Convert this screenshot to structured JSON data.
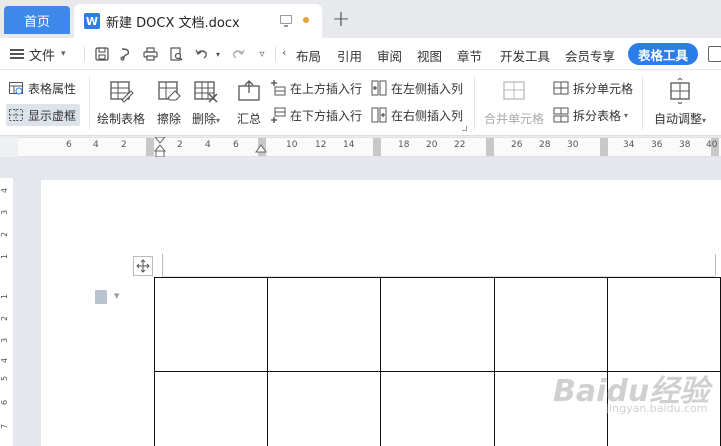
{
  "tabs": {
    "home": "首页",
    "document": "新建 DOCX 文档.docx",
    "doc_logo": "W"
  },
  "menu": {
    "file": "文件"
  },
  "ribbon_tabs": [
    "布局",
    "引用",
    "审阅",
    "视图",
    "章节",
    "开发工具",
    "会员专享"
  ],
  "active_tab": "表格工具",
  "toolbar": {
    "table_properties": "表格属性",
    "show_gridlines": "显示虚框",
    "draw_table": "绘制表格",
    "erase": "擦除",
    "delete": "删除",
    "summary": "汇总",
    "insert_row_above": "在上方插入行",
    "insert_row_below": "在下方插入行",
    "insert_col_left": "在左侧插入列",
    "insert_col_right": "在右侧插入列",
    "merge_cells": "合并单元格",
    "split_cells": "拆分单元格",
    "split_table": "拆分表格",
    "auto_fit": "自动调整"
  },
  "ruler": {
    "numbers": [
      "6",
      "4",
      "2",
      "2",
      "4",
      "6",
      "10",
      "12",
      "14",
      "18",
      "20",
      "22",
      "26",
      "28",
      "30",
      "34",
      "36",
      "38",
      "40"
    ]
  },
  "vruler": {
    "numbers": [
      "4",
      "3",
      "2",
      "1",
      "1",
      "2",
      "3",
      "4",
      "5",
      "6",
      "7"
    ]
  },
  "table": {
    "rows": 2,
    "cols": 5
  },
  "watermark": {
    "main": "Baidu经验",
    "sub": "jingyan.baidu.com"
  },
  "colors": {
    "accent": "#2b7de9",
    "home_tab": "#3d88e8"
  }
}
